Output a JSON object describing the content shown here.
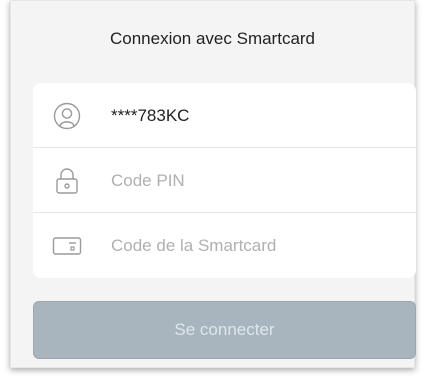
{
  "title": "Connexion avec Smartcard",
  "fields": {
    "user_id": {
      "value": "****783KC",
      "icon": "user-icon"
    },
    "pin": {
      "placeholder": "Code PIN",
      "icon": "lock-icon"
    },
    "smartcard": {
      "placeholder": "Code de la Smartcard",
      "icon": "card-reader-icon"
    }
  },
  "login_button": {
    "label": "Se connecter",
    "state": "disabled"
  },
  "colors": {
    "button_bg": "#a8b5be",
    "button_text": "#dfe6ea",
    "placeholder": "#b0b0b0",
    "text": "#222222"
  }
}
